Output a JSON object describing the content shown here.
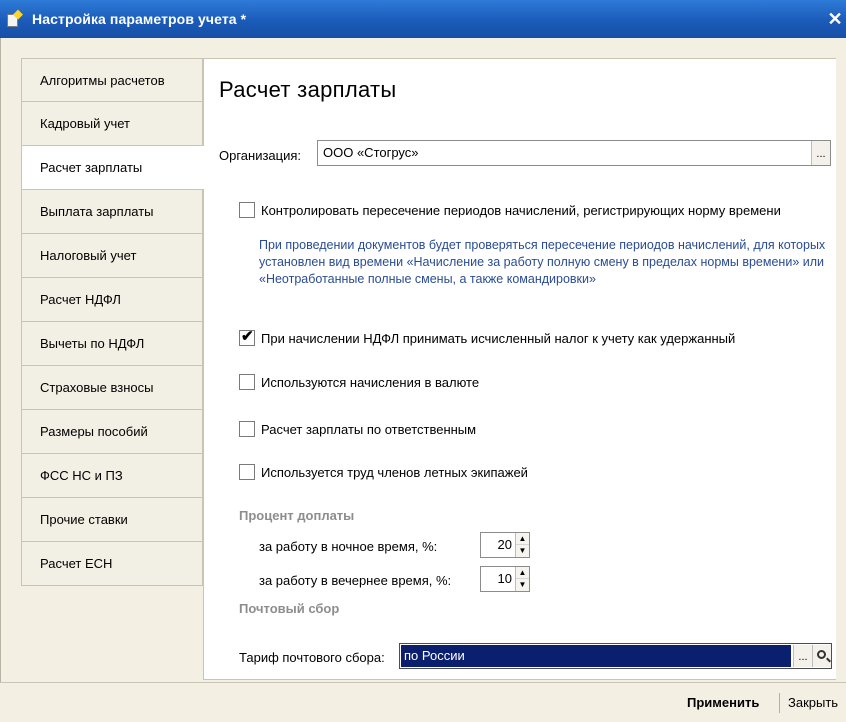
{
  "window": {
    "title": "Настройка параметров учета *",
    "close_glyph": "✕"
  },
  "sidebar": {
    "items": [
      {
        "label": "Алгоритмы расчетов",
        "active": false
      },
      {
        "label": "Кадровый учет",
        "active": false
      },
      {
        "label": "Расчет зарплаты",
        "active": true
      },
      {
        "label": "Выплата зарплаты",
        "active": false
      },
      {
        "label": "Налоговый учет",
        "active": false
      },
      {
        "label": "Расчет НДФЛ",
        "active": false
      },
      {
        "label": "Вычеты по НДФЛ",
        "active": false
      },
      {
        "label": "Страховые взносы",
        "active": false
      },
      {
        "label": "Размеры пособий",
        "active": false
      },
      {
        "label": "ФСС НС и ПЗ",
        "active": false
      },
      {
        "label": "Прочие ставки",
        "active": false
      },
      {
        "label": "Расчет ЕСН",
        "active": false
      }
    ]
  },
  "main": {
    "title": "Расчет зарплаты",
    "organization": {
      "label": "Организация:",
      "value": "ООО «Стогрус»",
      "button": "..."
    },
    "checkboxes": [
      {
        "label": "Контролировать пересечение периодов начислений, регистрирующих норму времени",
        "checked": false
      },
      {
        "label": "При начислении НДФЛ принимать исчисленный налог к учету как удержанный",
        "checked": true
      },
      {
        "label": "Используются начисления в валюте",
        "checked": false
      },
      {
        "label": "Расчет зарплаты по ответственным",
        "checked": false
      },
      {
        "label": "Используется труд членов летных экипажей",
        "checked": false
      }
    ],
    "hint": "При проведении документов будет проверяться пересечение периодов начислений, для которых установлен вид времени «Начисление за работу полную смену в пределах нормы времени» или «Неотработанные полные смены, а также командировки»",
    "surcharge": {
      "heading": "Процент доплаты",
      "night": {
        "label": "за работу в ночное время, %:",
        "value": "20"
      },
      "evening": {
        "label": "за работу в вечернее время, %:",
        "value": "10"
      }
    },
    "postal": {
      "heading": "Почтовый сбор",
      "tariff_label": "Тариф почтового сбора:",
      "tariff_value": "по России",
      "button": "..."
    }
  },
  "footer": {
    "apply": "Применить",
    "close": "Закрыть"
  },
  "colors": {
    "titlebar": "#1b5bb9",
    "hint_text": "#2a4c94",
    "selection": "#0a1f6e",
    "background": "#f3efe3"
  },
  "icons": {
    "check": "✔",
    "spin_up": "▲",
    "spin_down": "▼"
  }
}
